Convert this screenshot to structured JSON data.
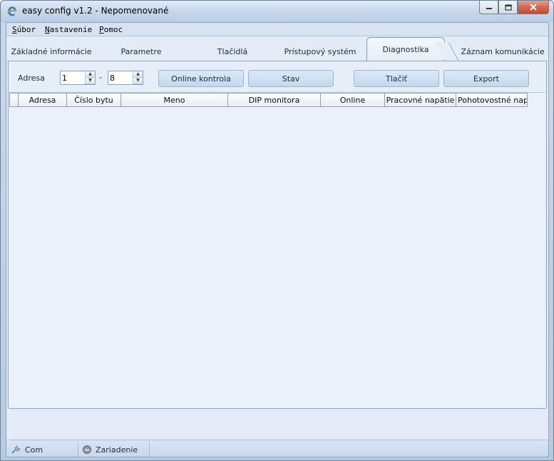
{
  "window": {
    "title": "easy config v1.2 - Nepomenované",
    "accent": "#c24a32"
  },
  "menu": {
    "items": [
      {
        "label": "Súbor",
        "hotkey": "S"
      },
      {
        "label": "Nastavenie",
        "hotkey": "N"
      },
      {
        "label": "Pomoc",
        "hotkey": "P"
      }
    ]
  },
  "tabs": [
    {
      "label": "Základné informácie"
    },
    {
      "label": "Parametre"
    },
    {
      "label": "Tlačidlá"
    },
    {
      "label": "Prístupový systém"
    },
    {
      "label": "Diagnostika",
      "active": true
    },
    {
      "label": "Záznam komunikácie"
    }
  ],
  "toolbar": {
    "address_label": "Adresa",
    "from_value": "1",
    "separator": "-",
    "to_value": "8",
    "online_check_label": "Online kontrola",
    "state_label": "Stav",
    "print_label": "Tlačiť",
    "export_label": "Export"
  },
  "table": {
    "columns": [
      "Adresa",
      "Číslo bytu",
      "Meno",
      "DIP monitora",
      "Online",
      "Pracovné napätie",
      "Pohotovostné napä"
    ],
    "rows": []
  },
  "status": {
    "com_label": "Com",
    "device_label": "Zariadenie",
    "com_icon": "plug-icon",
    "device_icon": "device-icon"
  }
}
